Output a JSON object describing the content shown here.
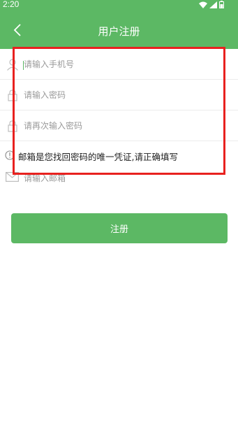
{
  "status_bar": {
    "time": "2:20"
  },
  "app_bar": {
    "title": "用户注册",
    "back_icon": "chevron-left-icon"
  },
  "form": {
    "phone": {
      "placeholder": "请输入手机号",
      "icon": "user-icon"
    },
    "password": {
      "placeholder": "请输入密码",
      "icon": "lock-icon"
    },
    "password_confirm": {
      "placeholder": "请再次输入密码",
      "icon": "lock-icon"
    },
    "hint": {
      "text": "邮箱是您找回密码的唯一凭证,请正确填写",
      "icon": "info-icon"
    },
    "email": {
      "placeholder": "请输入邮箱",
      "icon": "mail-icon"
    }
  },
  "register_button": {
    "label": "注册"
  },
  "colors": {
    "primary": "#5cb864",
    "highlight": "#e8211f",
    "placeholder": "#9a9a9a"
  }
}
